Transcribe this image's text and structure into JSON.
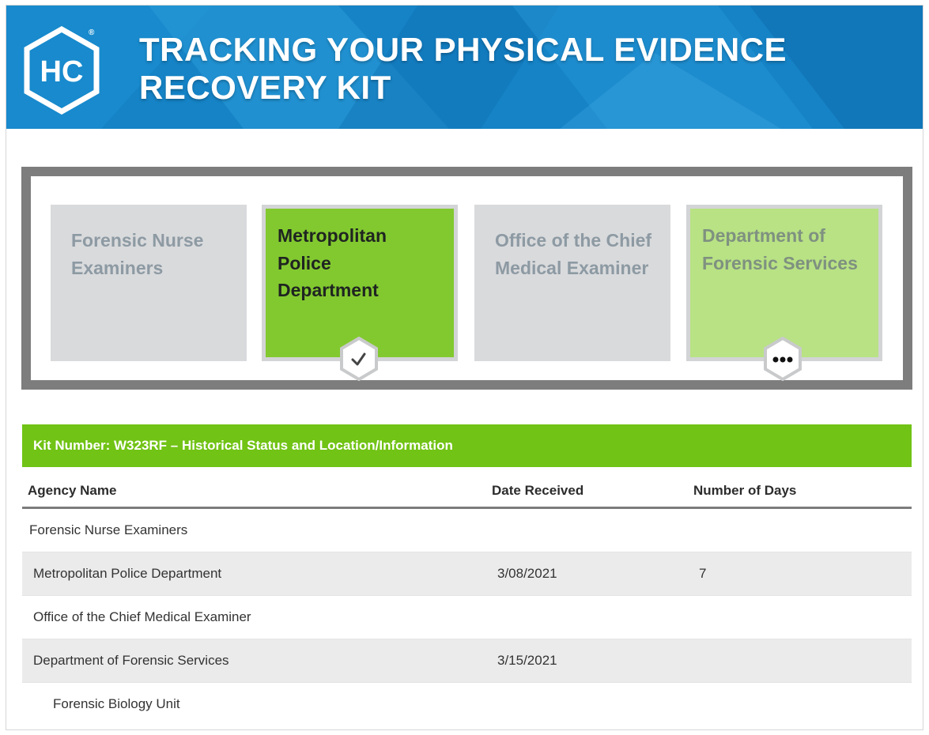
{
  "banner": {
    "logo_text": "HC",
    "registered_mark": "®",
    "title_line1": "TRACKING YOUR PHYSICAL EVIDENCE",
    "title_line2": "RECOVERY KIT"
  },
  "tracker": {
    "steps": [
      {
        "label": "Forensic Nurse Examiners",
        "state": "inactive"
      },
      {
        "label": "Metropolitan Police Department",
        "state": "completed",
        "badge_icon": "checkmark-icon"
      },
      {
        "label": "Office of the Chief Medical Examiner",
        "state": "inactive"
      },
      {
        "label": "Department of Forensic Services",
        "state": "in-progress",
        "badge_icon": "ellipsis-icon"
      }
    ]
  },
  "kit": {
    "header": "Kit Number: W323RF – Historical Status and Location/Information"
  },
  "table": {
    "columns": [
      "Agency Name",
      "Date Received",
      "Number of Days"
    ],
    "rows": [
      {
        "agency": "Forensic Nurse Examiners",
        "date": "",
        "days": ""
      },
      {
        "agency": "Metropolitan Police Department",
        "date": "3/08/2021",
        "days": "7"
      },
      {
        "agency": "Office of the Chief Medical Examiner",
        "date": "",
        "days": ""
      },
      {
        "agency": "Department of Forensic Services",
        "date": "3/15/2021",
        "days": ""
      },
      {
        "agency": "Forensic Biology Unit",
        "date": "",
        "days": ""
      }
    ]
  },
  "colors": {
    "banner_blue": "#1583c6",
    "active_green": "#82c92f",
    "pending_green": "#b8e284",
    "kit_bar_green": "#71c315",
    "inactive_grey": "#d9dadc"
  }
}
